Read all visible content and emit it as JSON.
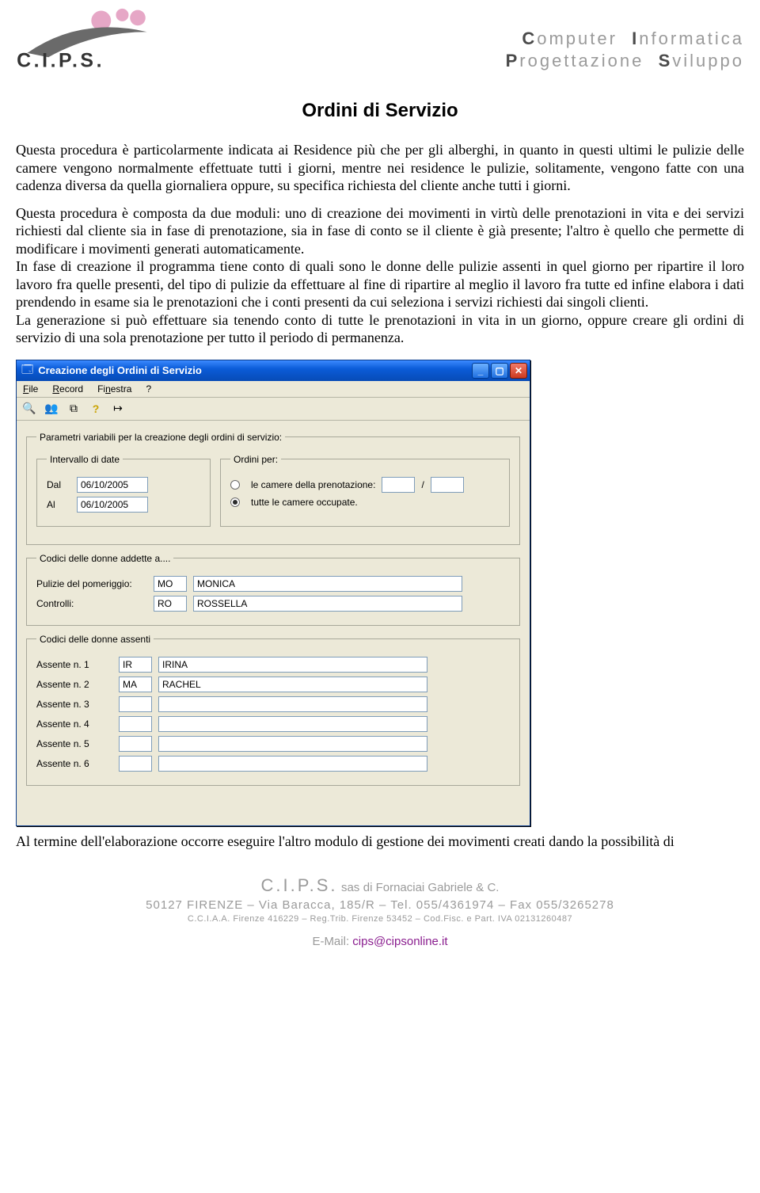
{
  "letterhead": {
    "logo_text": "C.I.P.S.",
    "tagline_line1_prefix": "C",
    "tagline_line1_word1": "omputer",
    "tagline_line1_prefix2": "I",
    "tagline_line1_word2": "nformatica",
    "tagline_line2_prefix": "P",
    "tagline_line2_word1": "rogettazione",
    "tagline_line2_prefix2": "S",
    "tagline_line2_word2": "viluppo"
  },
  "document": {
    "title": "Ordini di Servizio",
    "para1": "Questa procedura è particolarmente indicata ai Residence più che per gli alberghi, in quanto in questi ultimi le pulizie delle camere vengono normalmente effettuate tutti i giorni, mentre nei residence le pulizie, solitamente, vengono fatte con una cadenza diversa da quella giornaliera oppure, su specifica richiesta del cliente anche tutti i giorni.",
    "para2": "Questa procedura è composta da due moduli: uno di creazione dei movimenti in virtù delle prenotazioni in vita e dei servizi richiesti dal cliente sia in fase di prenotazione, sia in fase di conto se il cliente è già presente; l'altro è quello che permette di modificare i movimenti generati automaticamente.",
    "para3": "In fase di creazione il programma tiene conto di quali sono le donne delle pulizie assenti in quel giorno per ripartire il loro lavoro fra quelle presenti, del tipo di pulizie da effettuare al fine di ripartire al meglio il lavoro fra tutte ed infine elabora i dati prendendo in esame sia le prenotazioni che i conti presenti da cui seleziona i servizi richiesti dai singoli clienti.",
    "para4": "La generazione si può effettuare sia tenendo conto di tutte le prenotazioni in vita in un giorno, oppure creare gli ordini di servizio di una sola prenotazione per tutto il periodo di permanenza.",
    "after_dialog": "Al termine dell'elaborazione occorre eseguire l'altro modulo di gestione dei movimenti creati dando la possibilità di"
  },
  "dialog": {
    "title": "Creazione degli Ordini di Servizio",
    "menu": {
      "file": "File",
      "record": "Record",
      "finestra": "Finestra",
      "help": "?"
    },
    "group_main_legend": "Parametri variabili per la creazione degli ordini di servizio:",
    "group_dates_legend": "Intervallo di date",
    "label_dal": "Dal",
    "value_dal": "06/10/2005",
    "label_al": "Al",
    "value_al": "06/10/2005",
    "group_ordini_legend": "Ordini per:",
    "radio_camere_prenotazione": "le camere della prenotazione:",
    "radio_tutte_occupate": "tutte le camere occupate.",
    "prenotazione_p1": "",
    "prenotazione_sep": "/",
    "prenotazione_p2": "",
    "group_addette_legend": "Codici delle donne addette a....",
    "label_pomeriggio": "Pulizie del pomeriggio:",
    "code_pomeriggio": "MO",
    "name_pomeriggio": "MONICA",
    "label_controlli": "Controlli:",
    "code_controlli": "RO",
    "name_controlli": "ROSSELLA",
    "group_assenti_legend": "Codici delle donne assenti",
    "assenti": [
      {
        "label": "Assente n. 1",
        "code": "IR",
        "name": "IRINA"
      },
      {
        "label": "Assente n. 2",
        "code": "MA",
        "name": "RACHEL"
      },
      {
        "label": "Assente n. 3",
        "code": "",
        "name": ""
      },
      {
        "label": "Assente n. 4",
        "code": "",
        "name": ""
      },
      {
        "label": "Assente n. 5",
        "code": "",
        "name": ""
      },
      {
        "label": "Assente n. 6",
        "code": "",
        "name": ""
      }
    ]
  },
  "footer": {
    "company_big": "C.I.P.S.",
    "company_form": "sas",
    "company_of": "di Fornaciai Gabriele & C.",
    "addr": "50127 FIRENZE – Via Baracca, 185/R – Tel. 055/4361974 – Fax 055/3265278",
    "reg": "C.C.I.A.A. Firenze 416229 – Reg.Trib. Firenze 53452 – Cod.Fisc. e Part. IVA 02131260487",
    "email_label": "E-Mail: ",
    "email": "cips@cipsonline.it"
  }
}
